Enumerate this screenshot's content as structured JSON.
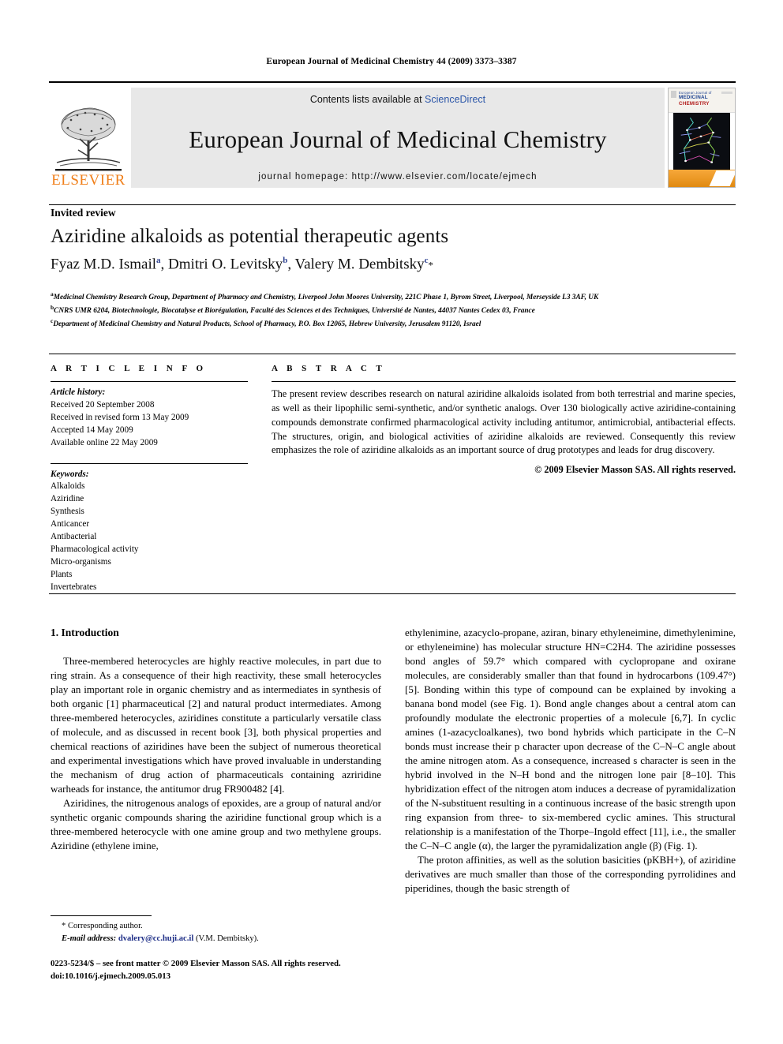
{
  "running_head": "European Journal of Medicinal Chemistry 44 (2009) 3373–3387",
  "masthead": {
    "publisher_name": "ELSEVIER",
    "contents_prefix": "Contents lists available at ",
    "contents_link": "ScienceDirect",
    "journal_title": "European Journal of Medicinal Chemistry",
    "homepage_label": "journal homepage: http://www.elsevier.com/locate/ejmech",
    "cover": {
      "line1": "European Journal of",
      "line2": "MEDICINAL",
      "line3": "CHEMISTRY"
    }
  },
  "article": {
    "type_label": "Invited review",
    "title": "Aziridine alkaloids as potential therapeutic agents",
    "authors": [
      {
        "name": "Fyaz M.D. Ismail",
        "sup": "a"
      },
      {
        "name": "Dmitri O. Levitsky",
        "sup": "b"
      },
      {
        "name": "Valery M. Dembitsky",
        "sup": "c"
      }
    ],
    "corresponding_marker": "*",
    "affiliations": [
      {
        "sup": "a",
        "text": "Medicinal Chemistry Research Group, Department of Pharmacy and Chemistry, Liverpool John Moores University, 221C Phase 1, Byrom Street, Liverpool, Merseyside L3 3AF, UK"
      },
      {
        "sup": "b",
        "text": "CNRS UMR 6204, Biotechnologie, Biocatalyse et Biorégulation, Faculté des Sciences et des Techniques, Université de Nantes, 44037 Nantes Cedex 03, France"
      },
      {
        "sup": "c",
        "text": "Department of Medicinal Chemistry and Natural Products, School of Pharmacy, P.O. Box 12065, Hebrew University, Jerusalem 91120, Israel"
      }
    ]
  },
  "article_info": {
    "heading": "A R T I C L E   I N F O",
    "history_label": "Article history:",
    "history": [
      "Received 20 September 2008",
      "Received in revised form 13 May 2009",
      "Accepted 14 May 2009",
      "Available online 22 May 2009"
    ],
    "keywords_label": "Keywords:",
    "keywords": [
      "Alkaloids",
      "Aziridine",
      "Synthesis",
      "Anticancer",
      "Antibacterial",
      "Pharmacological activity",
      "Micro-organisms",
      "Plants",
      "Invertebrates"
    ]
  },
  "abstract": {
    "heading": "A B S T R A C T",
    "body": "The present review describes research on natural aziridine alkaloids isolated from both terrestrial and marine species, as well as their lipophilic semi-synthetic, and/or synthetic analogs. Over 130 biologically active aziridine-containing compounds demonstrate confirmed pharmacological activity including antitumor, antimicrobial, antibacterial effects. The structures, origin, and biological activities of aziridine alkaloids are reviewed. Consequently this review emphasizes the role of aziridine alkaloids as an important source of drug prototypes and leads for drug discovery.",
    "copyright": "© 2009 Elsevier Masson SAS. All rights reserved."
  },
  "body": {
    "section_heading": "1. Introduction",
    "left_paragraphs": [
      "Three-membered heterocycles are highly reactive molecules, in part due to ring strain. As a consequence of their high reactivity, these small heterocycles play an important role in organic chemistry and as intermediates in synthesis of both organic [1] pharmaceutical [2] and natural product intermediates. Among three-membered heterocycles, aziridines constitute a particularly versatile class of molecule, and as discussed in recent book [3], both physical properties and chemical reactions of aziridines have been the subject of numerous theoretical and experimental investigations which have proved invaluable in understanding the mechanism of drug action of pharmaceuticals containing azriridine warheads for instance, the antitumor drug FR900482 [4].",
      "Aziridines, the nitrogenous analogs of epoxides, are a group of natural and/or synthetic organic compounds sharing the aziridine functional group which is a three-membered heterocycle with one amine group and two methylene groups. Aziridine (ethylene imine,"
    ],
    "right_paragraphs": [
      "ethylenimine, azacyclo-propane, aziran, binary ethyleneimine, dimethylenimine, or ethyleneimine) has molecular structure HN=C2H4. The aziridine possesses bond angles of 59.7° which compared with cyclopropane and oxirane molecules, are considerably smaller than that found in hydrocarbons (109.47°) [5]. Bonding within this type of compound can be explained by invoking a banana bond model (see Fig. 1). Bond angle changes about a central atom can profoundly modulate the electronic properties of a molecule [6,7]. In cyclic amines (1-azacycloalkanes), two bond hybrids which participate in the C–N bonds must increase their p character upon decrease of the C–N–C angle about the amine nitrogen atom. As a consequence, increased s character is seen in the hybrid involved in the N–H bond and the nitrogen lone pair [8–10]. This hybridization effect of the nitrogen atom induces a decrease of pyramidalization of the N-substituent resulting in a continuous increase of the basic strength upon ring expansion from three- to six-membered cyclic amines. This structural relationship is a manifestation of the Thorpe–Ingold effect [11], i.e., the smaller the C–N–C angle (α), the larger the pyramidalization angle (β) (Fig. 1).",
      "The proton affinities, as well as the solution basicities (pKBH+), of aziridine derivatives are much smaller than those of the corresponding pyrrolidines and piperidines, though the basic strength of"
    ]
  },
  "footnote": {
    "corresponding": "* Corresponding author.",
    "email_label": "E-mail address:",
    "email": "dvalery@cc.huji.ac.il",
    "email_owner": "(V.M. Dembitsky)."
  },
  "frontmatter": {
    "line1": "0223-5234/$ – see front matter © 2009 Elsevier Masson SAS. All rights reserved.",
    "line2": "doi:10.1016/j.ejmech.2009.05.013"
  },
  "colors": {
    "link": "#2b56a8",
    "reference": "#2b3f8f",
    "elsevier_orange": "#F07F1A"
  }
}
